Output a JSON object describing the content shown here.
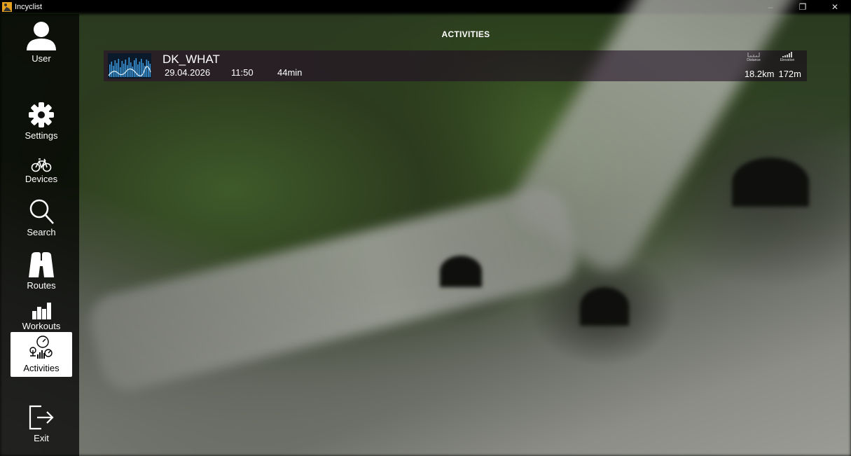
{
  "window": {
    "title": "Incyclist",
    "minimize_glyph": "–",
    "maximize_glyph": "❐",
    "close_glyph": "✕"
  },
  "sidebar": {
    "items": [
      {
        "label": "User",
        "icon": "user-icon"
      },
      {
        "label": "Settings",
        "icon": "gear-icon"
      },
      {
        "label": "Devices",
        "icon": "bicycle-icon"
      },
      {
        "label": "Search",
        "icon": "search-icon"
      },
      {
        "label": "Routes",
        "icon": "binoculars-icon"
      },
      {
        "label": "Workouts",
        "icon": "workout-bars-icon"
      },
      {
        "label": "Activities",
        "icon": "activities-icon",
        "active": true
      },
      {
        "label": "Exit",
        "icon": "exit-icon"
      }
    ]
  },
  "main": {
    "title": "ACTIVITIES",
    "activities": [
      {
        "name": "DK_WHAT",
        "date": "29.04.2026",
        "time": "11:50",
        "duration": "44min",
        "distance_caption": "Distance",
        "elevation_caption": "Elevation",
        "distance": "18.2km",
        "elevation": "172m"
      }
    ]
  },
  "colors": {
    "sidebar_bg": "#000000",
    "active_item_bg": "#ffffff",
    "thumb_bar": "#2f8fd6",
    "row_bg": "#2a0a2d"
  }
}
